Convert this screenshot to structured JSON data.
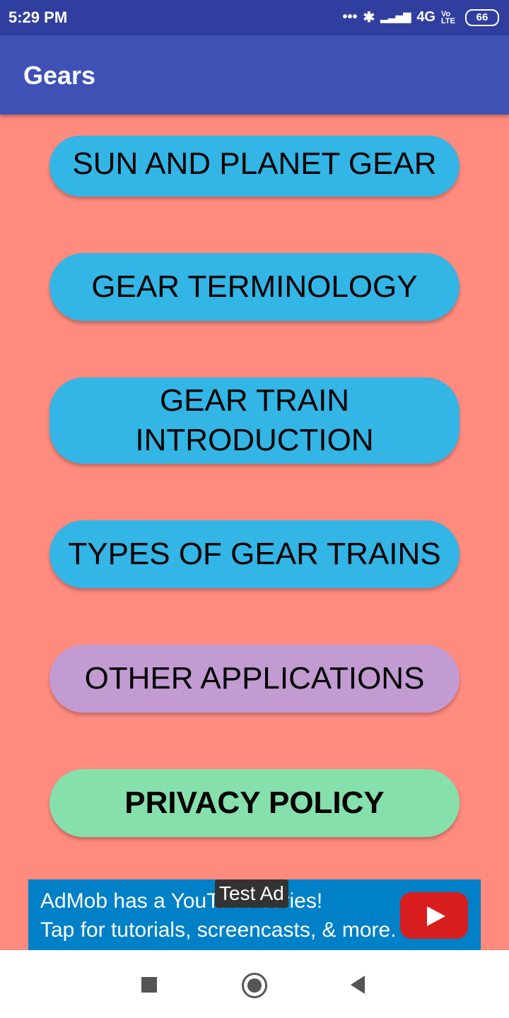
{
  "status_bar": {
    "time": "5:29 PM",
    "icons": {
      "dots": "•••",
      "bluetooth": "✱",
      "signal": "▂▃▅▇",
      "network": "4G",
      "volte": "Vo LTE"
    },
    "battery": "66"
  },
  "app_bar": {
    "title": "Gears"
  },
  "menu": {
    "items": [
      {
        "label": "SUN AND PLANET GEAR",
        "color": "#33b5e5"
      },
      {
        "label": "GEAR TERMINOLOGY",
        "color": "#33b5e5"
      },
      {
        "label": "GEAR TRAIN INTRODUCTION",
        "color": "#33b5e5"
      },
      {
        "label": "TYPES OF GEAR TRAINS",
        "color": "#33b5e5"
      },
      {
        "label": "OTHER APPLICATIONS",
        "color": "#c39bd3"
      },
      {
        "label": "PRIVACY POLICY",
        "color": "#85e0ac"
      }
    ]
  },
  "ad": {
    "line1": "AdMob has a YouTube series!",
    "line2": "Tap for tutorials, screencasts, & more.",
    "badge": "Test Ad",
    "icon": "youtube-play-icon"
  },
  "colors": {
    "background": "#ff8a7e",
    "app_bar": "#3f51b5",
    "status_bar": "#303f9f",
    "ad_banner": "#0080c6"
  }
}
